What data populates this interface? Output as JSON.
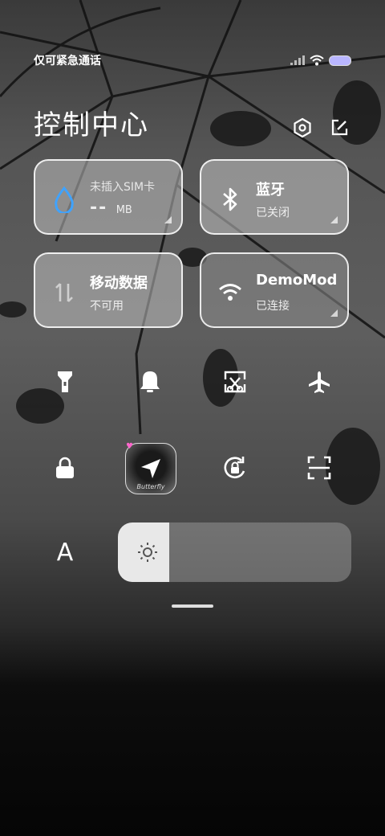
{
  "status_bar": {
    "carrier_text": "仅可紧急通话",
    "battery_color": "#b9b6ff"
  },
  "header": {
    "title": "控制中心"
  },
  "tiles": {
    "data_usage": {
      "line1": "未插入SIM卡",
      "value": "--",
      "unit": "MB",
      "icon": "water-drop-icon",
      "icon_color": "#3fa3ff"
    },
    "bluetooth": {
      "line1": "蓝牙",
      "line2": "已关闭",
      "icon": "bluetooth-icon"
    },
    "mobile_data": {
      "line1": "移动数据",
      "line2": "不可用",
      "icon": "data-arrows-icon"
    },
    "wifi": {
      "line1": "DemoMod",
      "line2": "已连接",
      "icon": "wifi-icon"
    }
  },
  "quick_toggles": [
    "flashlight-icon",
    "bell-icon",
    "screenshot-icon",
    "airplane-icon",
    "lock-icon",
    "location-icon",
    "rotation-lock-icon",
    "scan-icon"
  ],
  "location_button_caption": "Butterfly",
  "brightness": {
    "level": 0.22,
    "auto_label": "A"
  }
}
